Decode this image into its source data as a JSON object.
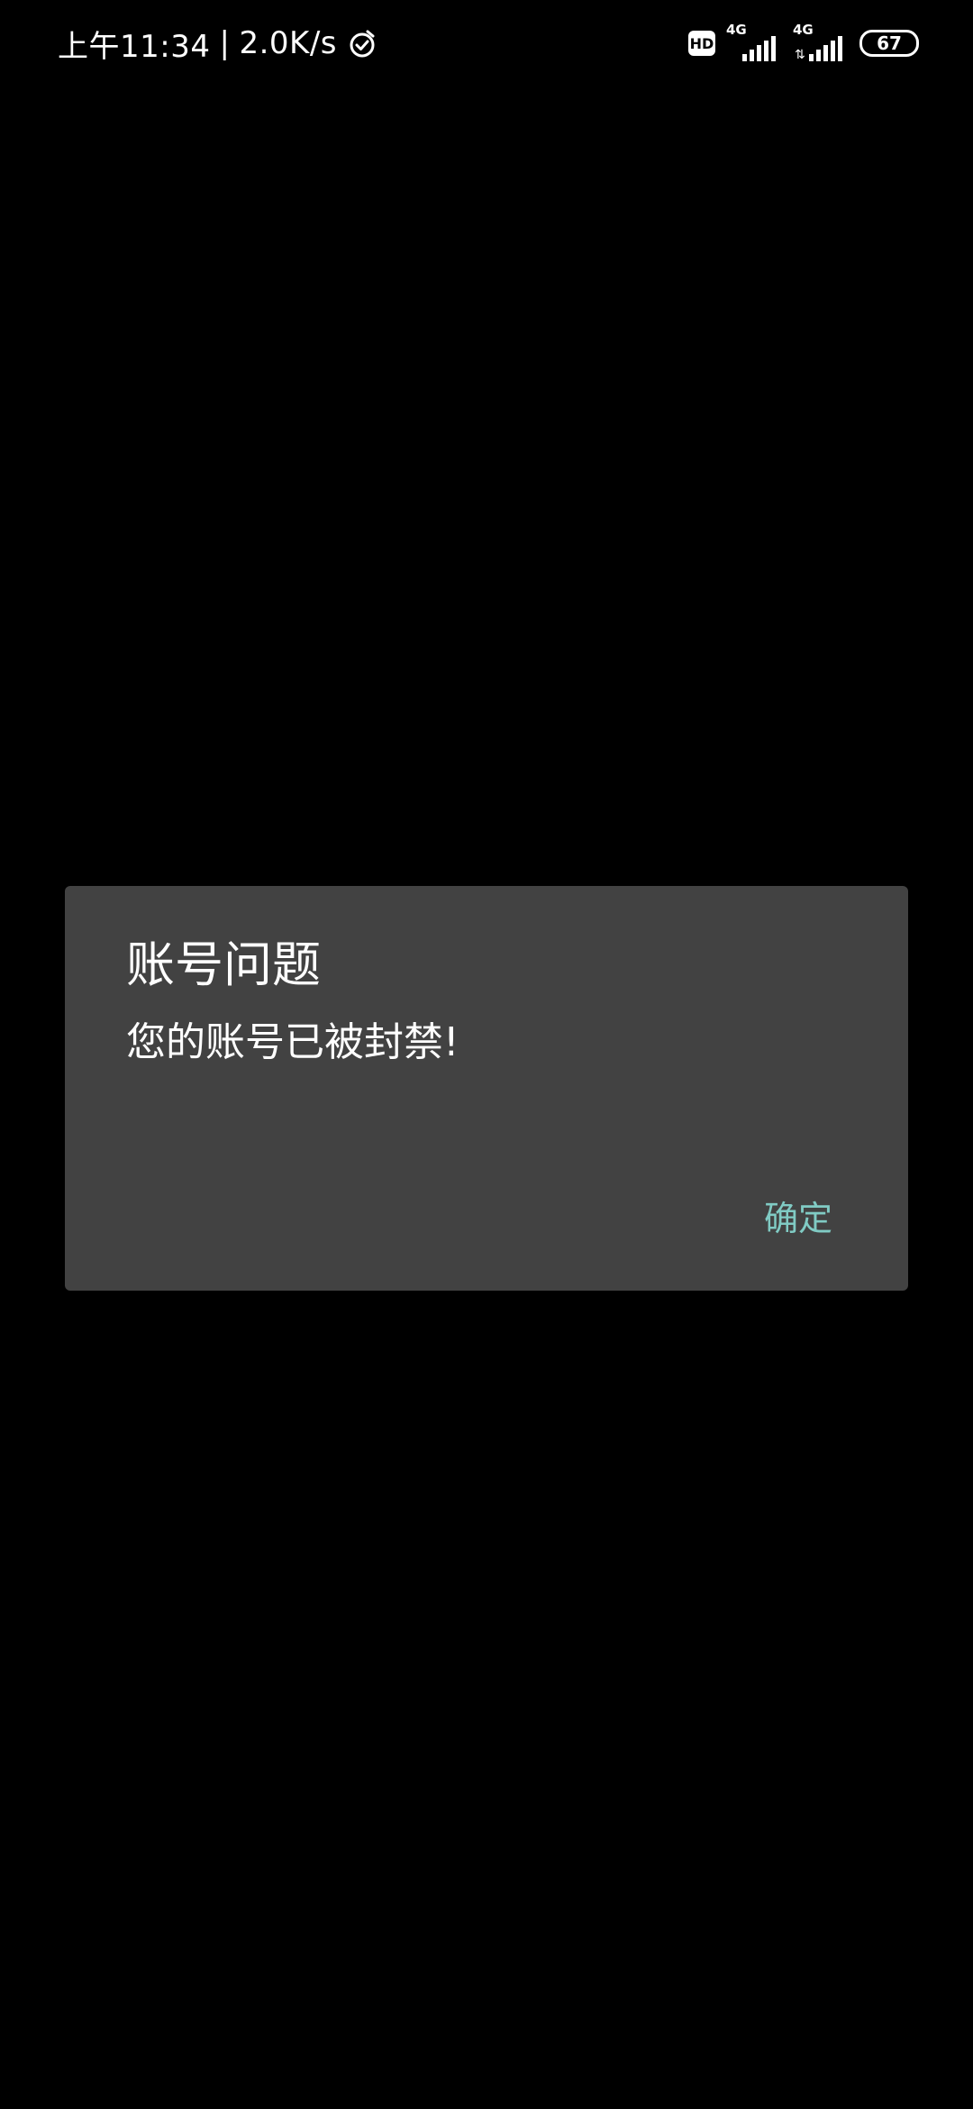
{
  "status_bar": {
    "time": "上午11:34",
    "separator": "|",
    "net_speed": "2.0K/s",
    "hd_label": "HD",
    "sim1_label": "4G",
    "sim2_label": "4G",
    "battery": "67"
  },
  "dialog": {
    "title": "账号问题",
    "message": "您的账号已被封禁!",
    "confirm_label": "确定"
  },
  "colors": {
    "background": "#000000",
    "dialog_bg": "#424242",
    "accent": "#80cbc4"
  },
  "icons": [
    "alarm-icon",
    "hd-icon",
    "signal-icon",
    "battery-icon"
  ]
}
